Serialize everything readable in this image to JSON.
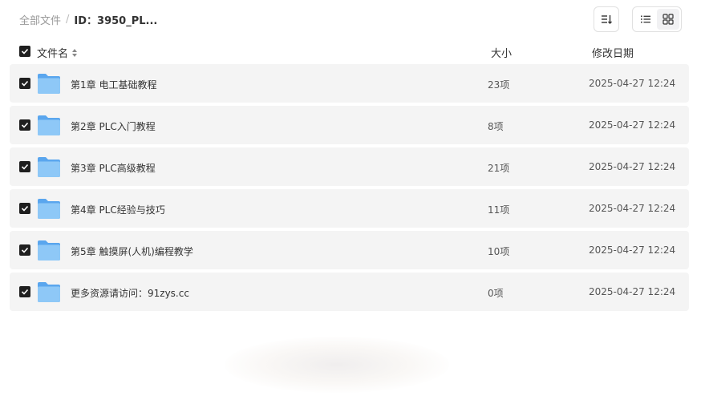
{
  "breadcrumb": {
    "root": "全部文件",
    "separator": "/",
    "current": "ID：3950_PL..."
  },
  "toolbar": {
    "sort_icon": "sort-icon",
    "list_icon": "list-view-icon",
    "grid_icon": "grid-view-icon"
  },
  "header": {
    "name": "文件名",
    "size": "大小",
    "date": "修改日期"
  },
  "files": [
    {
      "name": "第1章 电工基础教程",
      "size": "23项",
      "date": "2025-04-27 12:24"
    },
    {
      "name": "第2章 PLC入门教程",
      "size": "8项",
      "date": "2025-04-27 12:24"
    },
    {
      "name": "第3章 PLC高级教程",
      "size": "21项",
      "date": "2025-04-27 12:24"
    },
    {
      "name": "第4章 PLC经验与技巧",
      "size": "11项",
      "date": "2025-04-27 12:24"
    },
    {
      "name": "第5章 触摸屏(人机)编程教学",
      "size": "10项",
      "date": "2025-04-27 12:24"
    },
    {
      "name": "更多资源请访问：91zys.cc",
      "size": "0项",
      "date": "2025-04-27 12:24"
    }
  ],
  "colors": {
    "checkbox": "#1f1f1f",
    "row_bg": "#f4f4f4",
    "folder": "#6fb3f2"
  }
}
